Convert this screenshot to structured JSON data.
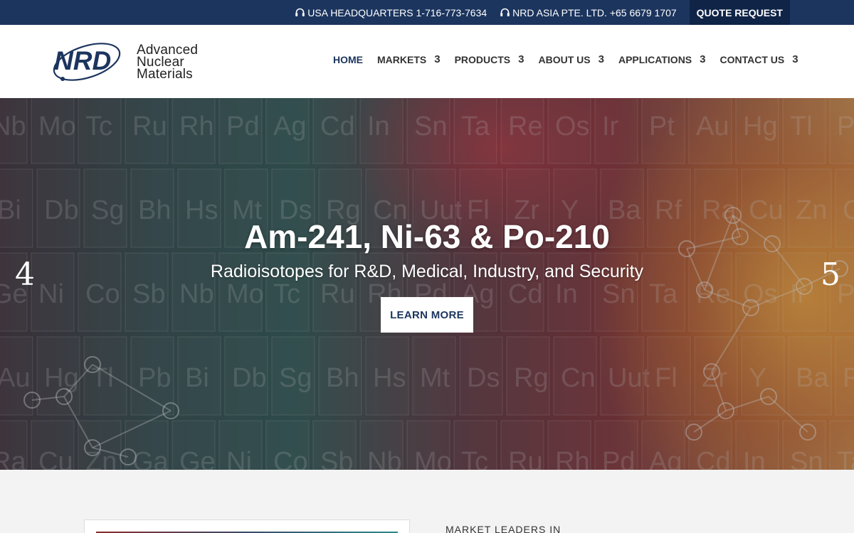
{
  "topbar": {
    "usa": "USA HEADQUARTERS 1-716-773-7634",
    "asia": "NRD ASIA PTE. LTD. +65 6679 1707",
    "quote": "QUOTE REQUEST"
  },
  "logo": {
    "mark": "NRD",
    "line1": "Advanced",
    "line2": "Nuclear",
    "line3": "Materials"
  },
  "nav": {
    "items": [
      {
        "label": "HOME",
        "chevron": ""
      },
      {
        "label": "MARKETS",
        "chevron": "3"
      },
      {
        "label": "PRODUCTS",
        "chevron": "3"
      },
      {
        "label": "ABOUT US",
        "chevron": "3"
      },
      {
        "label": "APPLICATIONS",
        "chevron": "3"
      },
      {
        "label": "CONTACT US",
        "chevron": "3"
      }
    ]
  },
  "hero": {
    "title": "Am-241, Ni-63 & Po-210",
    "subtitle": "Radioisotopes for R&D, Medical, Industry, and Security",
    "button": "LEARN MORE",
    "prev": "4",
    "next": "5",
    "elements": [
      "Nb",
      "Mo",
      "Tc",
      "Ru",
      "Rh",
      "Pd",
      "Ag",
      "Cd",
      "In",
      "Sn",
      "Ta",
      "Re",
      "Os",
      "Ir",
      "Pt",
      "Au",
      "Hg",
      "Tl",
      "Pb",
      "Bi",
      "Db",
      "Sg",
      "Bh",
      "Hs",
      "Mt",
      "Ds",
      "Rg",
      "Cn",
      "Uut",
      "Fl",
      "Zr",
      "Y",
      "Ba",
      "Rf",
      "Ra",
      "Cu",
      "Zn",
      "Ga",
      "Ge",
      "Ni",
      "Co",
      "Sb"
    ]
  },
  "below": {
    "heading": "MARKET LEADERS IN"
  },
  "colors": {
    "navy": "#1c355e",
    "quote_bg": "#0f2447"
  }
}
